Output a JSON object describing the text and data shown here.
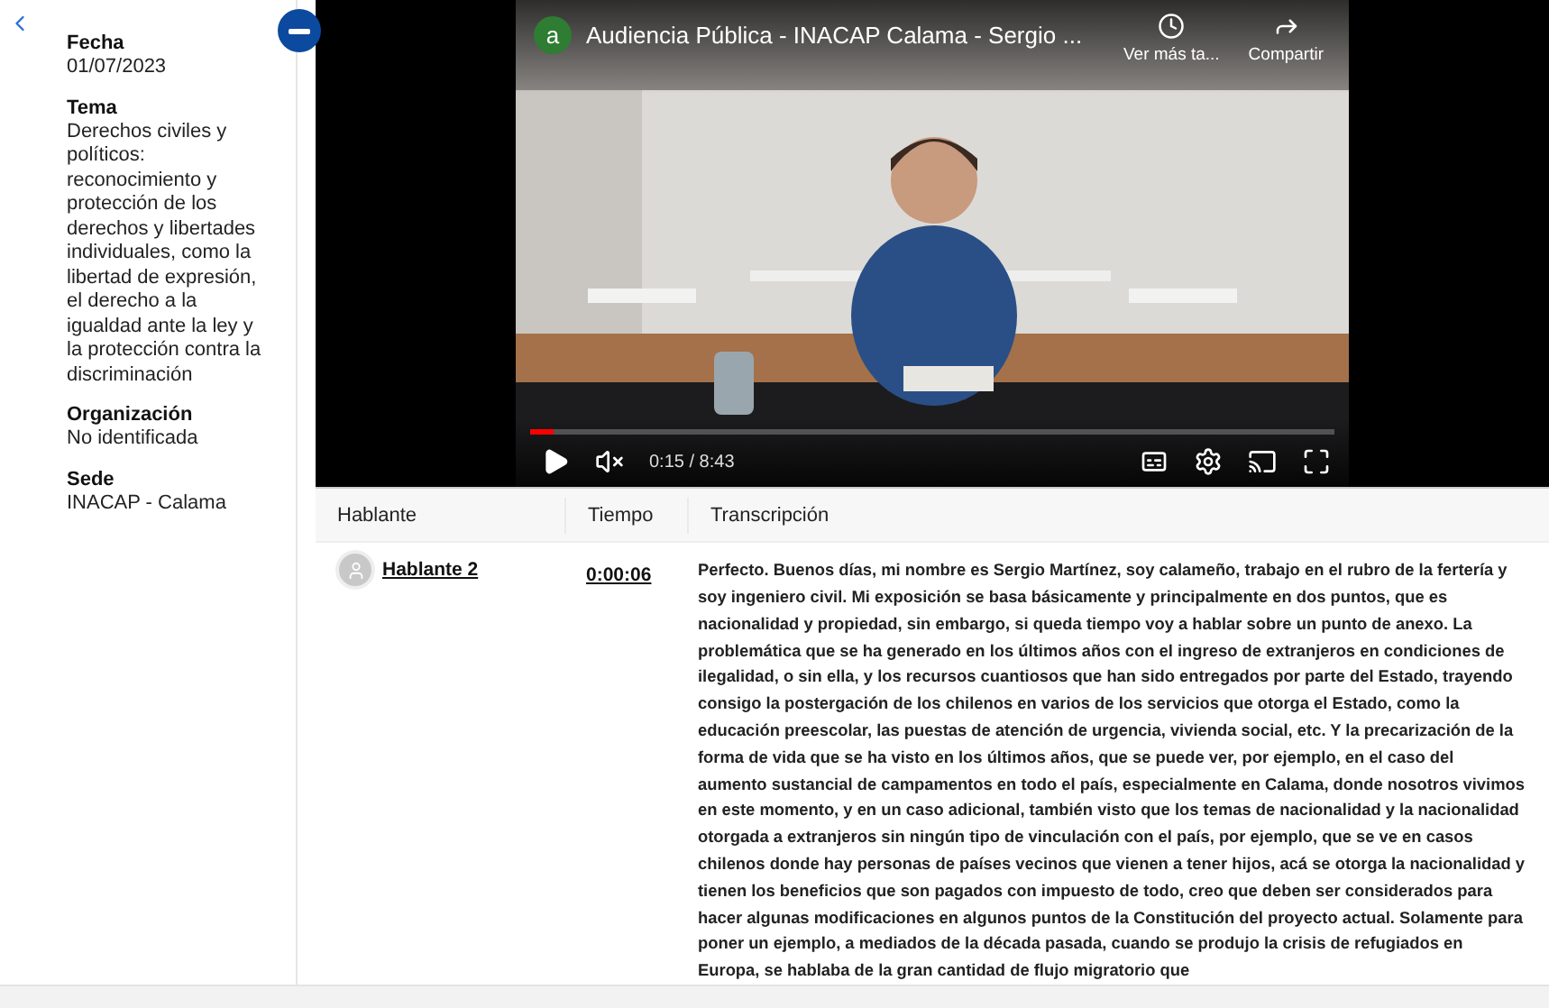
{
  "sidebar": {
    "fields": [
      {
        "label": "Fecha",
        "value": "01/07/2023"
      },
      {
        "label": "Tema",
        "value": "Derechos civiles y políticos: reconocimiento y protección de los derechos y libertades individuales, como la libertad de expresión, el derecho a la igualdad ante la ley y la protección contra la discriminación"
      },
      {
        "label": "Organización",
        "value": "No identificada"
      },
      {
        "label": "Sede",
        "value": "INACAP - Calama"
      }
    ]
  },
  "video": {
    "channel_initial": "a",
    "title": "Audiencia Pública - INACAP Calama - Sergio ...",
    "actions": [
      {
        "kind": "watch_later",
        "label": "Ver más ta..."
      },
      {
        "kind": "share",
        "label": "Compartir"
      }
    ],
    "muted": true,
    "time": "0:15 / 8:43",
    "progress": {
      "level": 0.03
    }
  },
  "table": {
    "columns": [
      "Hablante",
      "Tiempo",
      "Transcripción"
    ],
    "rows": [
      {
        "speaker": "Hablante 2",
        "time": "0:00:06",
        "text": "Perfecto. Buenos días, mi nombre es Sergio Martínez, soy calameño, trabajo en el rubro de la fertería y soy ingeniero civil. Mi exposición se basa básicamente y principalmente en dos puntos, que es nacionalidad y propiedad, sin embargo, si queda tiempo voy a hablar sobre un punto de anexo. La problemática que se ha generado en los últimos años con el ingreso de extranjeros en condiciones de ilegalidad, o sin ella, y los recursos cuantiosos que han sido entregados por parte del Estado, trayendo consigo la postergación de los chilenos en varios de los servicios que otorga el Estado, como la educación preescolar, las puestas de atención de urgencia, vivienda social, etc. Y la precarización de la forma de vida que se ha visto en los últimos años, que se puede ver, por ejemplo, en el caso del aumento sustancial de campamentos en todo el país, especialmente en Calama, donde nosotros vivimos en este momento, y en un caso adicional, también visto que los temas de nacionalidad y la nacionalidad otorgada a extranjeros sin ningún tipo de vinculación con el país, por ejemplo, que se ve en casos chilenos donde hay personas de países vecinos que vienen a tener hijos, acá se otorga la nacionalidad y tienen los beneficios que son pagados con impuesto de todo, creo que deben ser considerados para hacer algunas modificaciones en algunos puntos de la Constitución del proyecto actual. Solamente para poner un ejemplo, a mediados de la década pasada, cuando se produjo la crisis de refugiados en Europa, se hablaba de la gran cantidad de flujo migratorio que"
      }
    ]
  }
}
